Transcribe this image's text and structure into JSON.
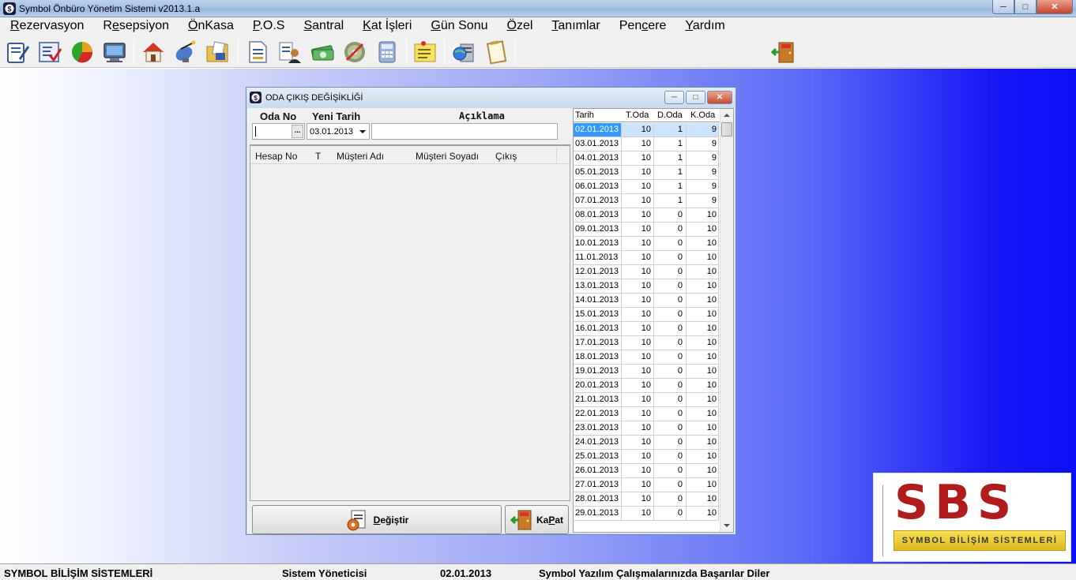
{
  "window": {
    "title": "Symbol Önbüro Yönetim Sistemi v2013.1.a",
    "min": "─",
    "max": "□",
    "close": "✕"
  },
  "menu": [
    {
      "pre": "",
      "ul": "R",
      "post": "ezervasyon"
    },
    {
      "pre": "R",
      "ul": "e",
      "post": "sepsiyon"
    },
    {
      "pre": "",
      "ul": "Ö",
      "post": "nKasa"
    },
    {
      "pre": "",
      "ul": "P",
      "post": ".O.S"
    },
    {
      "pre": "",
      "ul": "S",
      "post": "antral"
    },
    {
      "pre": "",
      "ul": "K",
      "post": "at İşleri"
    },
    {
      "pre": "",
      "ul": "G",
      "post": "ün Sonu"
    },
    {
      "pre": "",
      "ul": "Ö",
      "post": "zel"
    },
    {
      "pre": "",
      "ul": "T",
      "post": "anımlar"
    },
    {
      "pre": "Pen",
      "ul": "c",
      "post": "ere"
    },
    {
      "pre": "",
      "ul": "Y",
      "post": "ardım"
    }
  ],
  "dialog": {
    "title": "ODA ÇIKIŞ DEĞİŞİKLİĞİ",
    "oda_no_label": "Oda No",
    "yeni_tarih_label": "Yeni Tarih",
    "aciklama_label": "Açıklama",
    "ellipsis": "...",
    "date_value": "03.01.2013",
    "columns": [
      "Hesap No",
      "T",
      "Müşteri Adı",
      "Müşteri Soyadı",
      "Çıkış"
    ],
    "change_button": {
      "ul": "D",
      "post": "eğiştir"
    },
    "close_button": {
      "pre": "Ka",
      "ul": "P",
      "post": "at"
    }
  },
  "rooms_table": {
    "headers": [
      "Tarih",
      "T.Oda",
      "D.Oda",
      "K.Oda"
    ],
    "rows": [
      [
        "02.01.2013",
        "10",
        "1",
        "9"
      ],
      [
        "03.01.2013",
        "10",
        "1",
        "9"
      ],
      [
        "04.01.2013",
        "10",
        "1",
        "9"
      ],
      [
        "05.01.2013",
        "10",
        "1",
        "9"
      ],
      [
        "06.01.2013",
        "10",
        "1",
        "9"
      ],
      [
        "07.01.2013",
        "10",
        "1",
        "9"
      ],
      [
        "08.01.2013",
        "10",
        "0",
        "10"
      ],
      [
        "09.01.2013",
        "10",
        "0",
        "10"
      ],
      [
        "10.01.2013",
        "10",
        "0",
        "10"
      ],
      [
        "11.01.2013",
        "10",
        "0",
        "10"
      ],
      [
        "12.01.2013",
        "10",
        "0",
        "10"
      ],
      [
        "13.01.2013",
        "10",
        "0",
        "10"
      ],
      [
        "14.01.2013",
        "10",
        "0",
        "10"
      ],
      [
        "15.01.2013",
        "10",
        "0",
        "10"
      ],
      [
        "16.01.2013",
        "10",
        "0",
        "10"
      ],
      [
        "17.01.2013",
        "10",
        "0",
        "10"
      ],
      [
        "18.01.2013",
        "10",
        "0",
        "10"
      ],
      [
        "19.01.2013",
        "10",
        "0",
        "10"
      ],
      [
        "20.01.2013",
        "10",
        "0",
        "10"
      ],
      [
        "21.01.2013",
        "10",
        "0",
        "10"
      ],
      [
        "22.01.2013",
        "10",
        "0",
        "10"
      ],
      [
        "23.01.2013",
        "10",
        "0",
        "10"
      ],
      [
        "24.01.2013",
        "10",
        "0",
        "10"
      ],
      [
        "25.01.2013",
        "10",
        "0",
        "10"
      ],
      [
        "26.01.2013",
        "10",
        "0",
        "10"
      ],
      [
        "27.01.2013",
        "10",
        "0",
        "10"
      ],
      [
        "28.01.2013",
        "10",
        "0",
        "10"
      ],
      [
        "29.01.2013",
        "10",
        "0",
        "10"
      ]
    ]
  },
  "logo": {
    "big": "SBS",
    "tagline": "SYMBOL BİLİŞİM SİSTEMLERİ"
  },
  "status": {
    "company": "SYMBOL BİLİŞİM SİSTEMLERİ",
    "user": "Sistem Yöneticisi",
    "date": "02.01.2013",
    "message": "Symbol Yazılım Çalışmalarınızda Başarılar Diler"
  },
  "colors": {
    "brand_red": "#b01c1c",
    "selection_blue": "#3399ff",
    "desktop_blue": "#0a10f7"
  }
}
